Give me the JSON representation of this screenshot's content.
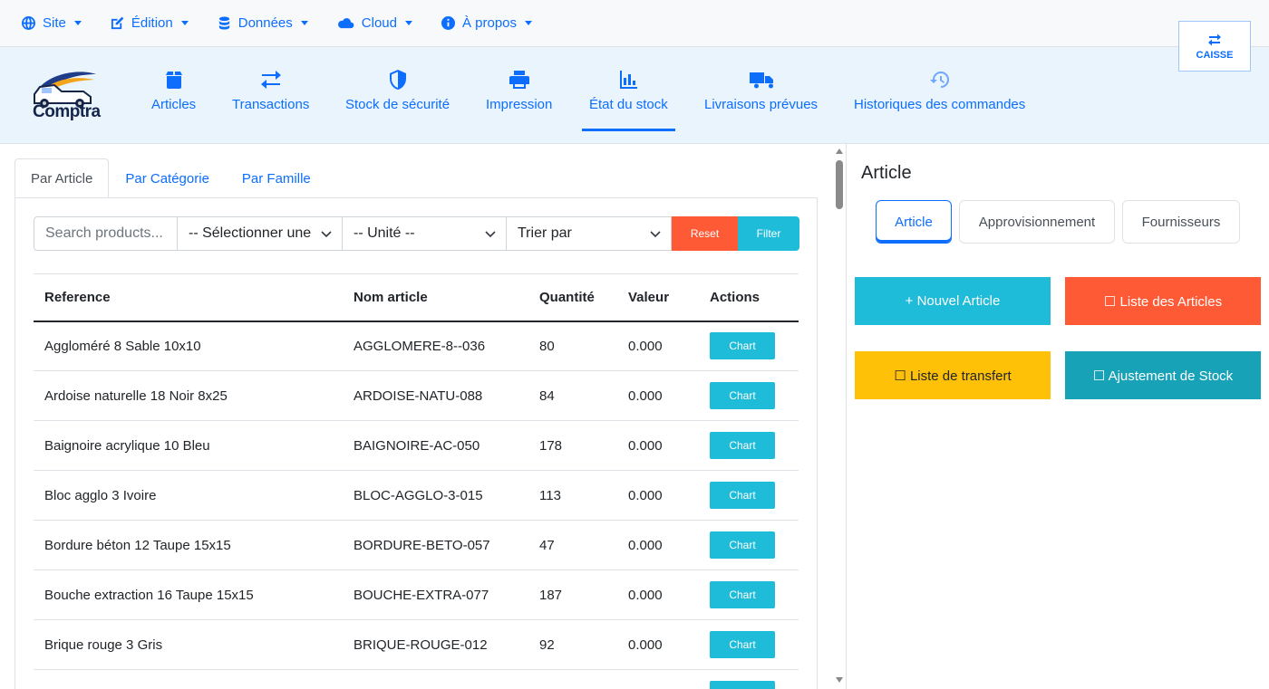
{
  "topmenu": {
    "items": [
      {
        "label": "Site",
        "icon": "globe-icon"
      },
      {
        "label": "Édition",
        "icon": "edit-icon"
      },
      {
        "label": "Données",
        "icon": "database-icon"
      },
      {
        "label": "Cloud",
        "icon": "cloud-icon"
      },
      {
        "label": "À propos",
        "icon": "info-icon"
      }
    ],
    "caisse_label": "CAISSE"
  },
  "brand": {
    "name": "Comptra"
  },
  "nav": {
    "items": [
      {
        "label": "Articles",
        "icon": "box-icon"
      },
      {
        "label": "Transactions",
        "icon": "exchange-icon"
      },
      {
        "label": "Stock de sécurité",
        "icon": "shield-icon"
      },
      {
        "label": "Impression",
        "icon": "printer-icon"
      },
      {
        "label": "État du stock",
        "icon": "chart-bar-icon",
        "active": true
      },
      {
        "label": "Livraisons prévues",
        "icon": "truck-icon"
      },
      {
        "label": "Historiques des commandes",
        "icon": "history-icon"
      }
    ]
  },
  "tabs": [
    "Par Article",
    "Par Catégorie",
    "Par Famille"
  ],
  "filters": {
    "search_placeholder": "Search products...",
    "category_select": "-- Sélectionner une",
    "unit_select": "-- Unité --",
    "sort_select": "Trier par",
    "reset_label": "Reset",
    "filter_label": "Filter"
  },
  "table": {
    "headers": [
      "Reference",
      "Nom article",
      "Quantité",
      "Valeur",
      "Actions"
    ],
    "action_label": "Chart",
    "rows": [
      {
        "reference": "Aggloméré 8 Sable 10x10",
        "nom": "AGGLOMERE-8--036",
        "quantite": "80",
        "valeur": "0.000"
      },
      {
        "reference": "Ardoise naturelle 18 Noir 8x25",
        "nom": "ARDOISE-NATU-088",
        "quantite": "84",
        "valeur": "0.000"
      },
      {
        "reference": "Baignoire acrylique 10 Bleu",
        "nom": "BAIGNOIRE-AC-050",
        "quantite": "178",
        "valeur": "0.000"
      },
      {
        "reference": "Bloc agglo 3 Ivoire",
        "nom": "BLOC-AGGLO-3-015",
        "quantite": "113",
        "valeur": "0.000"
      },
      {
        "reference": "Bordure béton 12 Taupe 15x15",
        "nom": "BORDURE-BETO-057",
        "quantite": "47",
        "valeur": "0.000"
      },
      {
        "reference": "Bouche extraction 16 Taupe 15x15",
        "nom": "BOUCHE-EXTRA-077",
        "quantite": "187",
        "valeur": "0.000"
      },
      {
        "reference": "Brique rouge 3 Gris",
        "nom": "BRIQUE-ROUGE-012",
        "quantite": "92",
        "valeur": "0.000"
      }
    ]
  },
  "right": {
    "title": "Article",
    "tabs": [
      "Article",
      "Approvisionnement",
      "Fournisseurs"
    ],
    "buttons": [
      {
        "label": "+ Nouvel Article",
        "color": "#1ebcd9",
        "text_color": "#ffffff"
      },
      {
        "label": "☐ Liste des Articles",
        "color": "#ff5a36",
        "text_color": "#ffffff"
      },
      {
        "label": "☐ Liste de transfert",
        "color": "#ffc107",
        "text_color": "#212529"
      },
      {
        "label": "☐ Ajustement de Stock",
        "color": "#17a2b8",
        "text_color": "#ffffff"
      }
    ]
  },
  "colors": {
    "primary": "#0d6efd",
    "info": "#1ebcd9",
    "danger": "#ff5a36",
    "warning": "#ffc107"
  }
}
